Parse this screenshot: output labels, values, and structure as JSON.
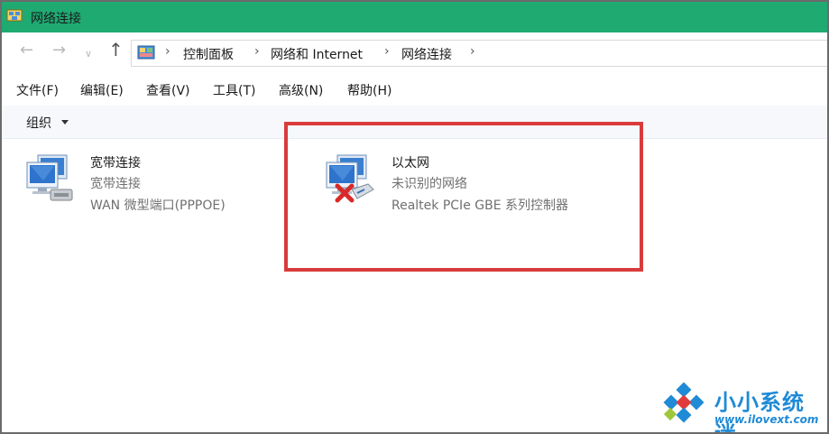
{
  "window": {
    "title": "网络连接"
  },
  "address_bar": {
    "crumbs": [
      "控制面板",
      "网络和 Internet",
      "网络连接"
    ]
  },
  "menu": {
    "items": [
      "文件(F)",
      "编辑(E)",
      "查看(V)",
      "工具(T)",
      "高级(N)",
      "帮助(H)"
    ]
  },
  "toolbar": {
    "organize": "组织"
  },
  "connections": [
    {
      "name": "宽带连接",
      "status": "宽带连接",
      "device": "WAN 微型端口(PPPOE)"
    },
    {
      "name": "以太网",
      "status": "未识别的网络",
      "device": "Realtek PCIe GBE 系列控制器"
    }
  ],
  "watermark": {
    "title": "小小系统迷",
    "url": "www.ilovext.com"
  },
  "colors": {
    "titlebar": "#1faa72",
    "highlight": "#d93b3b",
    "watermark": "#1f8ad6"
  }
}
